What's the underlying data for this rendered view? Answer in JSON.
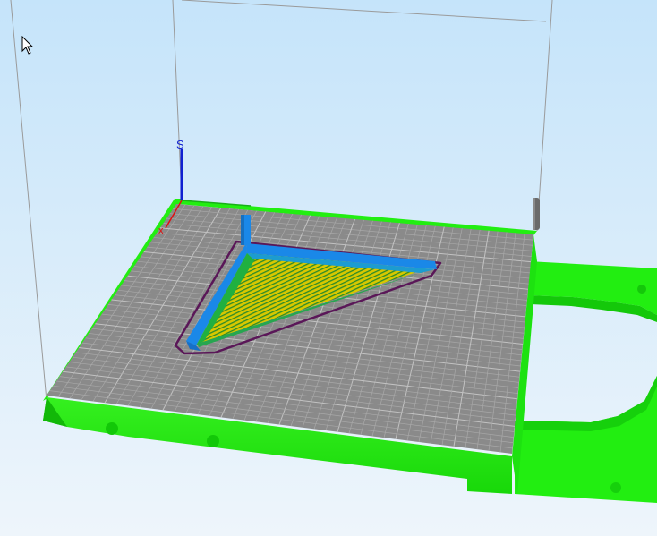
{
  "app": {
    "view": "3d-print-preview"
  },
  "colors": {
    "background_top": "#c5e4fa",
    "background_bottom": "#eef5fb",
    "bed_surface": "#8a8a8a",
    "bed_grid": "#aaaaaa",
    "bed_frame": "#22ee11",
    "infill": "#d8c800",
    "perimeter": "#1a88e8",
    "skirt": "#5a1758",
    "build_volume_edge": "#9a9a9a",
    "axis_x": "#e01010",
    "axis_y": "#18b018",
    "axis_z": "#1020d0"
  },
  "icons": {
    "cursor": "mouse-pointer-icon",
    "z_axis": "z-axis-icon",
    "origin": "origin-x-icon"
  }
}
